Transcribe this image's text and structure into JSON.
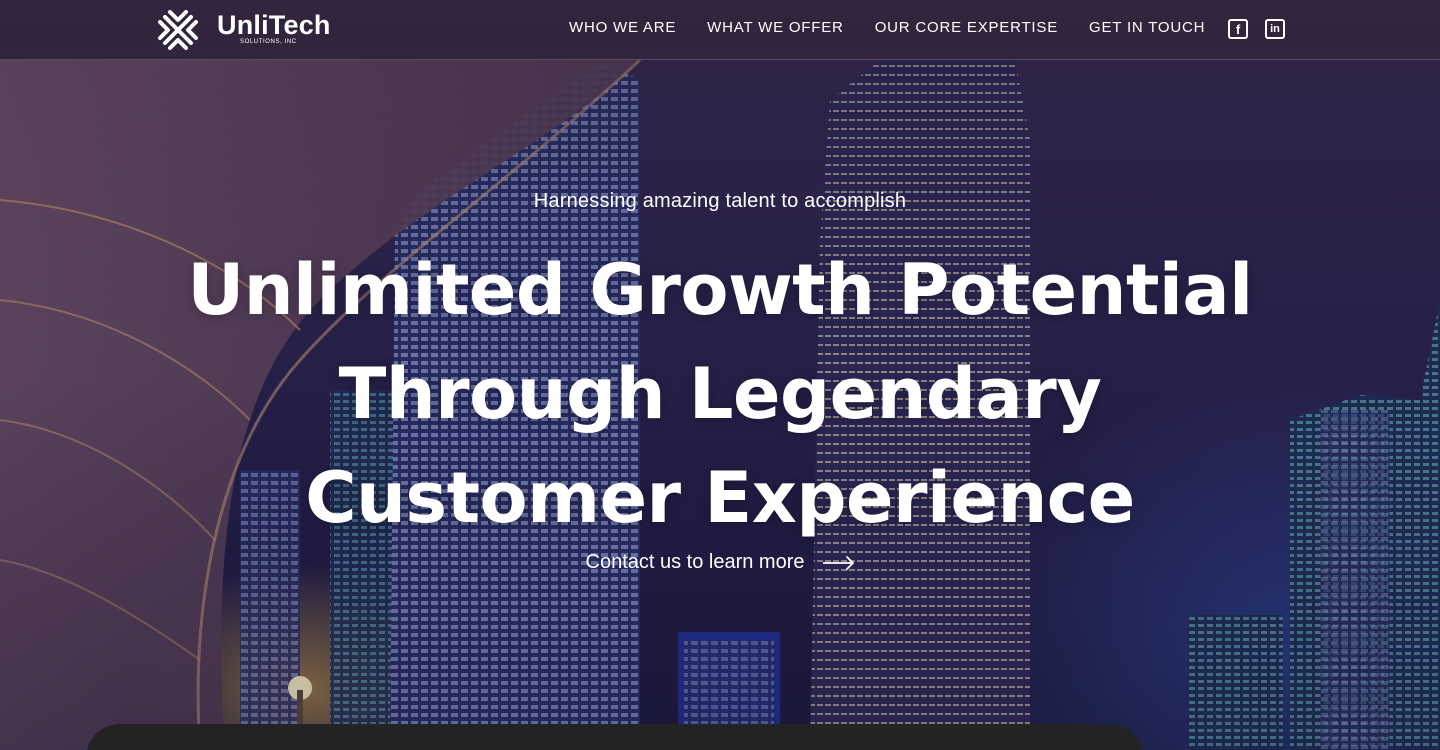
{
  "brand": {
    "name": "UnliTech",
    "subtitle": "SOLUTIONS, INC",
    "logo_icon": "knot-logo-icon",
    "color_text": "#ffffff"
  },
  "nav": {
    "items": [
      {
        "label": "WHO WE ARE"
      },
      {
        "label": "WHAT WE OFFER"
      },
      {
        "label": "OUR CORE EXPERTISE"
      },
      {
        "label": "GET IN TOUCH"
      }
    ]
  },
  "social": {
    "facebook": {
      "glyph": "f",
      "icon": "facebook-icon"
    },
    "linkedin": {
      "glyph": "in",
      "icon": "linkedin-icon"
    }
  },
  "hero": {
    "tagline": "Harnessing amazing talent to accomplish",
    "headline_lines": [
      "Unlimited Growth Potential",
      "Through Legendary",
      "Customer Experience"
    ],
    "cta_label": "Contact us to learn more",
    "cta_icon": "arrow-right-icon"
  },
  "colors": {
    "header_bg": "#34263c",
    "bottom_panel": "#232325"
  }
}
